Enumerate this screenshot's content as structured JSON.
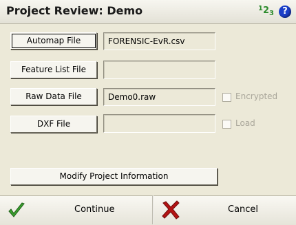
{
  "window": {
    "title": "Project Review: Demo",
    "input_mode": {
      "first": "1",
      "second": "2",
      "third": "3"
    },
    "help_label": "?"
  },
  "rows": [
    {
      "button": "Automap File",
      "value": "FORENSIC-EvR.csv"
    },
    {
      "button": "Feature List File",
      "value": ""
    },
    {
      "button": "Raw Data File",
      "value": "Demo0.raw",
      "checkbox": "Encrypted",
      "checked": false
    },
    {
      "button": "DXF File",
      "value": "",
      "checkbox": "Load",
      "checked": false
    }
  ],
  "modify_button": "Modify Project Information",
  "footer": {
    "continue_label": "Continue",
    "cancel_label": "Cancel"
  },
  "colors": {
    "title_accent": "#2d8b2d",
    "help_icon": "#1b3fc9",
    "continue_check": "#3aa02e",
    "cancel_x": "#b41414"
  }
}
